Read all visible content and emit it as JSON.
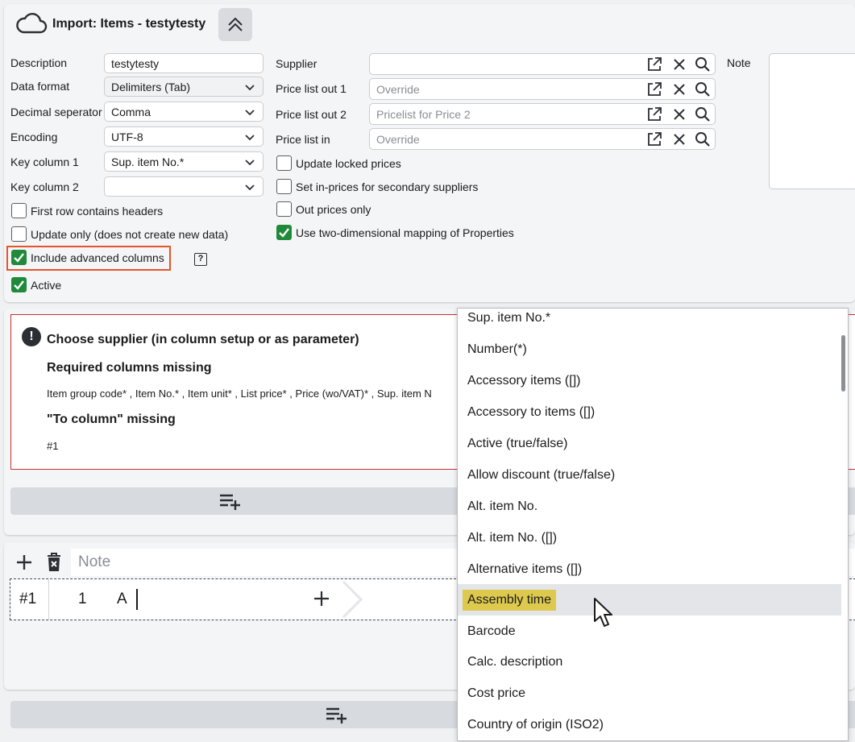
{
  "header": {
    "title": "Import: Items - testytesty"
  },
  "form": {
    "description": {
      "label": "Description",
      "value": "testytesty"
    },
    "data_format": {
      "label": "Data format",
      "value": "Delimiters (Tab)"
    },
    "decimal_separator": {
      "label": "Decimal seperator",
      "value": "Comma"
    },
    "encoding": {
      "label": "Encoding",
      "value": "UTF-8"
    },
    "key_column_1": {
      "label": "Key column 1",
      "value": "Sup. item No.*"
    },
    "key_column_2": {
      "label": "Key column 2",
      "value": ""
    },
    "first_row_headers": {
      "label": "First row contains headers",
      "checked": false
    },
    "update_only": {
      "label": "Update only (does not create new data)",
      "checked": false
    },
    "include_advanced": {
      "label": "Include advanced columns",
      "checked": true
    },
    "active": {
      "label": "Active",
      "checked": true
    },
    "supplier": {
      "label": "Supplier",
      "value": "",
      "placeholder": ""
    },
    "price_list_out_1": {
      "label": "Price list out 1",
      "placeholder": "Override"
    },
    "price_list_out_2": {
      "label": "Price list out 2",
      "placeholder": "Pricelist for Price 2"
    },
    "price_list_in": {
      "label": "Price list in",
      "placeholder": "Override"
    },
    "update_locked_prices": {
      "label": "Update locked prices",
      "checked": false
    },
    "set_in_prices_secondary": {
      "label": "Set in-prices for secondary suppliers",
      "checked": false
    },
    "out_prices_only": {
      "label": "Out prices only",
      "checked": false
    },
    "two_dim_mapping": {
      "label": "Use two-dimensional mapping of Properties",
      "checked": true
    },
    "note": {
      "label": "Note",
      "value": ""
    },
    "help_glyph": "?"
  },
  "validation": {
    "title": "Choose supplier (in column setup or as parameter)",
    "required_heading": "Required columns missing",
    "required_list": "Item group code* , Item No.* , Item unit* , List price* , Price (wo/VAT)* , Sup. item N",
    "to_column_heading": "\"To column\" missing",
    "to_column_value": "#1"
  },
  "columns_toolbar": {
    "note_placeholder": "Note"
  },
  "column_row": {
    "id": "#1",
    "index": "1",
    "letter": "A"
  },
  "dropdown": {
    "items": [
      "Sup. item No.*",
      "Number(*)",
      "Accessory items ([])",
      "Accessory to items ([])",
      "Active (true/false)",
      "Allow discount (true/false)",
      "Alt. item No.",
      "Alt. item No. ([])",
      "Alternative items ([])",
      "Assembly time",
      "Barcode",
      "Calc. description",
      "Cost price",
      "Country of origin (ISO2)"
    ],
    "hovered_index": 9
  },
  "colors": {
    "accent_green": "#1f8a3a",
    "highlight_outline": "#e8542a",
    "error_border": "#c8322f",
    "hover_highlight": "#dcc94e"
  }
}
